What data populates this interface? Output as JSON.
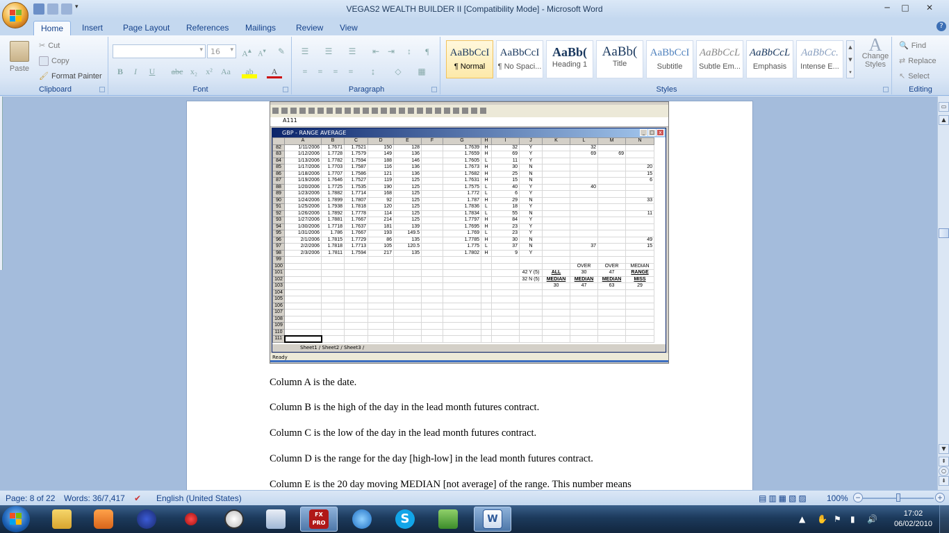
{
  "window": {
    "title": "VEGAS2 WEALTH BUILDER II [Compatibility Mode] - Microsoft Word",
    "controls": [
      "minimize",
      "maximize",
      "close"
    ]
  },
  "ribbon_tabs": [
    "Home",
    "Insert",
    "Page Layout",
    "References",
    "Mailings",
    "Review",
    "View"
  ],
  "clipboard": {
    "paste": "Paste",
    "cut": "Cut",
    "copy": "Copy",
    "format_painter": "Format Painter",
    "label": "Clipboard"
  },
  "font": {
    "name_value": "",
    "size_value": "16",
    "label": "Font"
  },
  "paragraph": {
    "label": "Paragraph"
  },
  "styles": {
    "label": "Styles",
    "items": [
      {
        "sample": "AaBbCcI",
        "name": "¶ Normal"
      },
      {
        "sample": "AaBbCcI",
        "name": "¶ No Spaci..."
      },
      {
        "sample": "AaBb(",
        "name": "Heading 1"
      },
      {
        "sample": "AaBb(",
        "name": "Title"
      },
      {
        "sample": "AaBbCcI",
        "name": "Subtitle"
      },
      {
        "sample": "AaBbCcL",
        "name": "Subtle Em..."
      },
      {
        "sample": "AaBbCcL",
        "name": "Emphasis"
      },
      {
        "sample": "AaBbCc.",
        "name": "Intense E..."
      }
    ],
    "change_styles": "Change Styles"
  },
  "editing": {
    "find": "Find",
    "replace": "Replace",
    "select": "Select",
    "label": "Editing"
  },
  "excel": {
    "namebox": "A111",
    "window_title": "GBP - RANGE AVERAGE",
    "columns": [
      "A",
      "B",
      "C",
      "D",
      "E",
      "F",
      "G",
      "H",
      "I",
      "J",
      "K",
      "L",
      "M",
      "N"
    ],
    "rows": [
      [
        "82",
        "1/11/2006",
        "1.7671",
        "1.7521",
        "150",
        "128",
        "",
        "1.7639",
        "H",
        "32",
        "Y",
        "",
        "32",
        "",
        ""
      ],
      [
        "83",
        "1/12/2006",
        "1.7728",
        "1.7579",
        "149",
        "136",
        "",
        "1.7659",
        "H",
        "69",
        "Y",
        "",
        "69",
        "69",
        ""
      ],
      [
        "84",
        "1/13/2006",
        "1.7782",
        "1.7594",
        "188",
        "146",
        "",
        "1.7605",
        "L",
        "11",
        "Y",
        "",
        "",
        "",
        ""
      ],
      [
        "85",
        "1/17/2006",
        "1.7703",
        "1.7587",
        "116",
        "136",
        "",
        "1.7673",
        "H",
        "30",
        "N",
        "",
        "",
        "",
        "20"
      ],
      [
        "86",
        "1/18/2006",
        "1.7707",
        "1.7586",
        "121",
        "136",
        "",
        "1.7682",
        "H",
        "25",
        "N",
        "",
        "",
        "",
        "15"
      ],
      [
        "87",
        "1/19/2006",
        "1.7646",
        "1.7527",
        "119",
        "125",
        "",
        "1.7631",
        "H",
        "15",
        "N",
        "",
        "",
        "",
        "6"
      ],
      [
        "88",
        "1/20/2006",
        "1.7725",
        "1.7535",
        "190",
        "125",
        "",
        "1.7575",
        "L",
        "40",
        "Y",
        "",
        "40",
        "",
        ""
      ],
      [
        "89",
        "1/23/2006",
        "1.7882",
        "1.7714",
        "168",
        "125",
        "",
        "1.772",
        "L",
        "6",
        "Y",
        "",
        "",
        "",
        ""
      ],
      [
        "90",
        "1/24/2006",
        "1.7899",
        "1.7807",
        "92",
        "125",
        "",
        "1.787",
        "H",
        "29",
        "N",
        "",
        "",
        "",
        "33"
      ],
      [
        "91",
        "1/25/2006",
        "1.7938",
        "1.7818",
        "120",
        "125",
        "",
        "1.7836",
        "L",
        "18",
        "Y",
        "",
        "",
        "",
        ""
      ],
      [
        "92",
        "1/26/2006",
        "1.7892",
        "1.7778",
        "114",
        "125",
        "",
        "1.7834",
        "L",
        "55",
        "N",
        "",
        "",
        "",
        "11"
      ],
      [
        "93",
        "1/27/2006",
        "1.7881",
        "1.7667",
        "214",
        "125",
        "",
        "1.7797",
        "H",
        "84",
        "Y",
        "",
        "",
        "",
        ""
      ],
      [
        "94",
        "1/30/2006",
        "1.7718",
        "1.7637",
        "181",
        "139",
        "",
        "1.7695",
        "H",
        "23",
        "Y",
        "",
        "",
        "",
        ""
      ],
      [
        "95",
        "1/31/2006",
        "1.786",
        "1.7667",
        "193",
        "149.5",
        "",
        "1.769",
        "L",
        "23",
        "Y",
        "",
        "",
        "",
        ""
      ],
      [
        "96",
        "2/1/2006",
        "1.7815",
        "1.7729",
        "86",
        "135",
        "",
        "1.7785",
        "H",
        "30",
        "N",
        "",
        "",
        "",
        "49"
      ],
      [
        "97",
        "2/2/2006",
        "1.7818",
        "1.7713",
        "105",
        "120.5",
        "",
        "1.775",
        "L",
        "37",
        "N",
        "",
        "37",
        "",
        "15"
      ],
      [
        "98",
        "2/3/2006",
        "1.7811",
        "1.7594",
        "217",
        "135",
        "",
        "1.7802",
        "H",
        "9",
        "Y",
        "",
        "",
        "",
        ""
      ],
      [
        "99",
        "",
        "",
        "",
        "",
        "",
        "",
        "",
        "",
        "",
        "",
        "",
        "",
        "",
        ""
      ],
      [
        "100",
        "",
        "",
        "",
        "",
        "",
        "",
        "",
        "",
        "",
        "",
        "",
        "OVER",
        "OVER",
        "MEDIAN"
      ],
      [
        "101",
        "",
        "",
        "",
        "",
        "",
        "",
        "",
        "",
        "",
        "42 Y (5)",
        "ALL",
        "30",
        "47",
        "RANGE"
      ],
      [
        "102",
        "",
        "",
        "",
        "",
        "",
        "",
        "",
        "",
        "",
        "32 N (5)",
        "MEDIAN",
        "MEDIAN",
        "MEDIAN",
        "MISS"
      ],
      [
        "103",
        "",
        "",
        "",
        "",
        "",
        "",
        "",
        "",
        "",
        "",
        "30",
        "47",
        "63",
        "29"
      ],
      [
        "104",
        "",
        "",
        "",
        "",
        "",
        "",
        "",
        "",
        "",
        "",
        "",
        "",
        "",
        ""
      ],
      [
        "105",
        "",
        "",
        "",
        "",
        "",
        "",
        "",
        "",
        "",
        "",
        "",
        "",
        "",
        ""
      ],
      [
        "106",
        "",
        "",
        "",
        "",
        "",
        "",
        "",
        "",
        "",
        "",
        "",
        "",
        "",
        ""
      ],
      [
        "107",
        "",
        "",
        "",
        "",
        "",
        "",
        "",
        "",
        "",
        "",
        "",
        "",
        "",
        ""
      ],
      [
        "108",
        "",
        "",
        "",
        "",
        "",
        "",
        "",
        "",
        "",
        "",
        "",
        "",
        "",
        ""
      ],
      [
        "109",
        "",
        "",
        "",
        "",
        "",
        "",
        "",
        "",
        "",
        "",
        "",
        "",
        "",
        ""
      ],
      [
        "110",
        "",
        "",
        "",
        "",
        "",
        "",
        "",
        "",
        "",
        "",
        "",
        "",
        "",
        ""
      ],
      [
        "111",
        "",
        "",
        "",
        "",
        "",
        "",
        "",
        "",
        "",
        "",
        "",
        "",
        "",
        ""
      ]
    ],
    "sheets": "Sheet1 / Sheet2 / Sheet3 /",
    "status": "Ready"
  },
  "document": {
    "paragraphs": [
      "Column A is the date.",
      "Column B is the high of the day in the lead month futures contract.",
      "Column C is the low of the day in the lead month futures contract.",
      "Column D is the range  for the day [high-low]  in the lead month futures contract.",
      "Column E is the 20 day moving  MEDIAN  [not average]  of the range.  This number means"
    ]
  },
  "statusbar": {
    "page": "Page: 8 of 22",
    "words": "Words: 36/7,417",
    "language": "English (United States)",
    "zoom": "100%"
  },
  "taskbar": {
    "apps": [
      "explorer",
      "media-player",
      "user-accounts",
      "pushpin",
      "clock",
      "folder",
      "fxpro",
      "internet-explorer",
      "skype",
      "people",
      "word"
    ],
    "fxpro_label": "FX PRO",
    "time": "17:02",
    "date": "06/02/2010"
  }
}
